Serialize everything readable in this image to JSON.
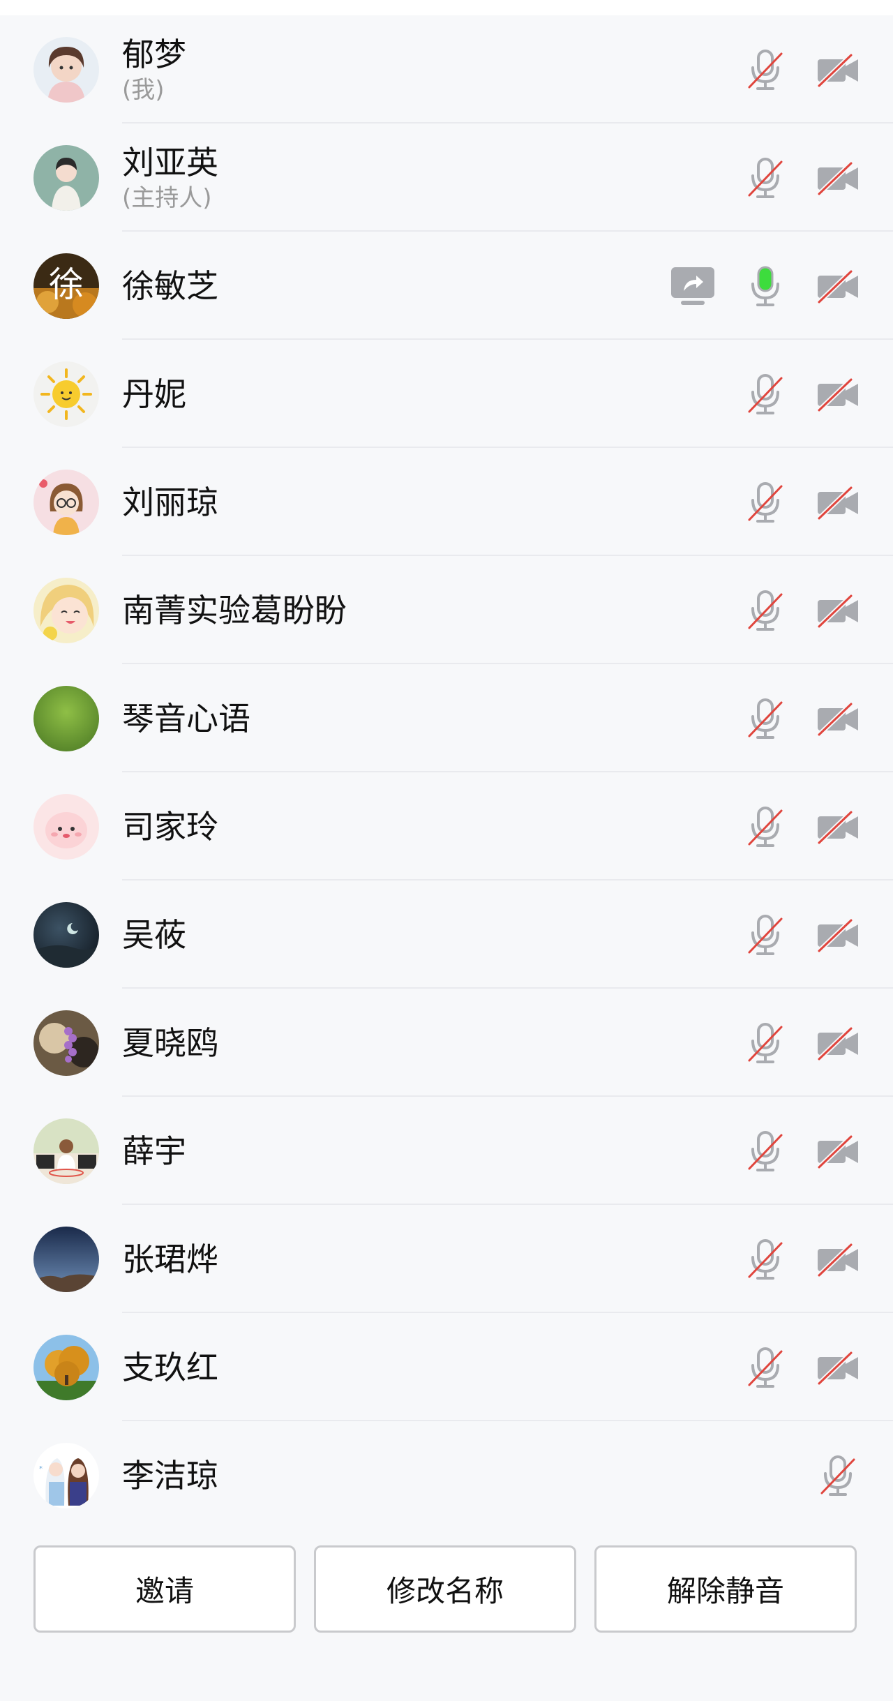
{
  "participants": [
    {
      "name": "郁梦",
      "role": "(我)",
      "share": false,
      "mic": "muted",
      "cam": "off",
      "avatar": "girl-portrait-avatar"
    },
    {
      "name": "刘亚英",
      "role": "(主持人)",
      "share": false,
      "mic": "muted",
      "cam": "off",
      "avatar": "woman-illustration-avatar"
    },
    {
      "name": "徐敏芝",
      "role": "",
      "share": true,
      "mic": "active",
      "cam": "off",
      "avatar": "calligraphy-character-avatar",
      "avatar_char": "徐"
    },
    {
      "name": "丹妮",
      "role": "",
      "share": false,
      "mic": "muted",
      "cam": "off",
      "avatar": "sun-cartoon-avatar"
    },
    {
      "name": "刘丽琼",
      "role": "",
      "share": false,
      "mic": "muted",
      "cam": "off",
      "avatar": "girl-glasses-cartoon-avatar"
    },
    {
      "name": "南菁实验葛盼盼",
      "role": "",
      "share": false,
      "mic": "muted",
      "cam": "off",
      "avatar": "anime-girl-avatar"
    },
    {
      "name": "琴音心语",
      "role": "",
      "share": false,
      "mic": "muted",
      "cam": "off",
      "avatar": "grass-field-avatar"
    },
    {
      "name": "司家玲",
      "role": "",
      "share": false,
      "mic": "muted",
      "cam": "off",
      "avatar": "pink-blob-cartoon-avatar"
    },
    {
      "name": "吴莜",
      "role": "",
      "share": false,
      "mic": "muted",
      "cam": "off",
      "avatar": "night-sky-avatar"
    },
    {
      "name": "夏晓鸥",
      "role": "",
      "share": false,
      "mic": "muted",
      "cam": "off",
      "avatar": "lavender-flowers-avatar"
    },
    {
      "name": "薛宇",
      "role": "",
      "share": false,
      "mic": "muted",
      "cam": "off",
      "avatar": "child-photo-avatar"
    },
    {
      "name": "张珺烨",
      "role": "",
      "share": false,
      "mic": "muted",
      "cam": "off",
      "avatar": "mountain-dusk-avatar"
    },
    {
      "name": "支玖红",
      "role": "",
      "share": false,
      "mic": "muted",
      "cam": "off",
      "avatar": "autumn-tree-avatar"
    },
    {
      "name": "李洁琼",
      "role": "",
      "share": false,
      "mic": "muted",
      "cam": "none",
      "avatar": "princess-cartoon-avatar"
    }
  ],
  "buttons": {
    "invite": "邀请",
    "rename": "修改名称",
    "unmute": "解除静音"
  },
  "colors": {
    "muted_icon": "#a9abb0",
    "strike": "#e0453d",
    "active_mic": "#3ddc3d",
    "text": "#111111",
    "subtext": "#9a9a9a",
    "background": "#f7f8fa",
    "divider": "#e9eaee"
  }
}
